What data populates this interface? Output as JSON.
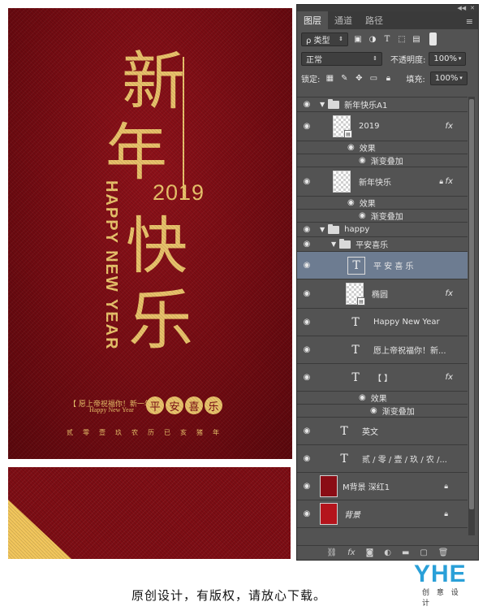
{
  "poster": {
    "char_xin": "新",
    "char_nian": "年",
    "char_kuai": "快",
    "char_le": "乐",
    "year": "2019",
    "happy_new_year": "HAPPY NEW YEAR",
    "blessing_cn": "【 愿上帝祝福你！新一年 】",
    "blessing_en": "Happy New Year",
    "seal_chars": [
      "平",
      "安",
      "喜",
      "乐"
    ],
    "bottom_chars": [
      "贰",
      "零",
      "壹",
      "玖",
      "农",
      "历",
      "已",
      "亥",
      "猪",
      "年"
    ]
  },
  "panel": {
    "tabs": [
      "图层",
      "通道",
      "路径"
    ],
    "filter_label": "ρ 类型",
    "blend_mode": "正常",
    "opacity_label": "不透明度:",
    "opacity_value": "100%",
    "lock_label": "锁定:",
    "fill_label": "填充:",
    "fill_value": "100%",
    "layers": [
      {
        "kind": "group",
        "name": "新年快乐A1"
      },
      {
        "kind": "smart",
        "name": "2019",
        "fx": "fx"
      },
      {
        "kind": "effect",
        "name": "效果"
      },
      {
        "kind": "effect-sub",
        "name": "渐变叠加"
      },
      {
        "kind": "layer",
        "name": "新年快乐",
        "fx": "fx"
      },
      {
        "kind": "effect",
        "name": "效果"
      },
      {
        "kind": "effect-sub",
        "name": "渐变叠加"
      },
      {
        "kind": "group",
        "name": "happy"
      },
      {
        "kind": "subgroup",
        "name": "平安喜乐"
      },
      {
        "kind": "text-selected",
        "name": "平 安 喜 乐"
      },
      {
        "kind": "smart",
        "name": "椭圆",
        "fx": "fx"
      },
      {
        "kind": "text",
        "name": "Happy New Year"
      },
      {
        "kind": "text",
        "name": "愿上帝祝福你！新..."
      },
      {
        "kind": "text",
        "name": "【                    】",
        "fx": "fx"
      },
      {
        "kind": "effect",
        "name": "效果"
      },
      {
        "kind": "effect-sub",
        "name": "渐变叠加"
      },
      {
        "kind": "text",
        "name": "英文"
      },
      {
        "kind": "text",
        "name": "贰 / 零 / 壹 / 玖 / 农 /..."
      },
      {
        "kind": "image",
        "name": "M背景 深红1"
      },
      {
        "kind": "bg",
        "name": "背景"
      }
    ]
  },
  "footer": {
    "caption": "原创设计，有版权，请放心下载。",
    "logo": "YHE",
    "logo_sub": "创 意 设 计"
  },
  "colors": {
    "poster_red": "#7e0d14",
    "gold": "#e9c26a",
    "panel_bg": "#535353",
    "selected_row": "#6d7c91",
    "logo_blue": "#2aa0d8"
  }
}
